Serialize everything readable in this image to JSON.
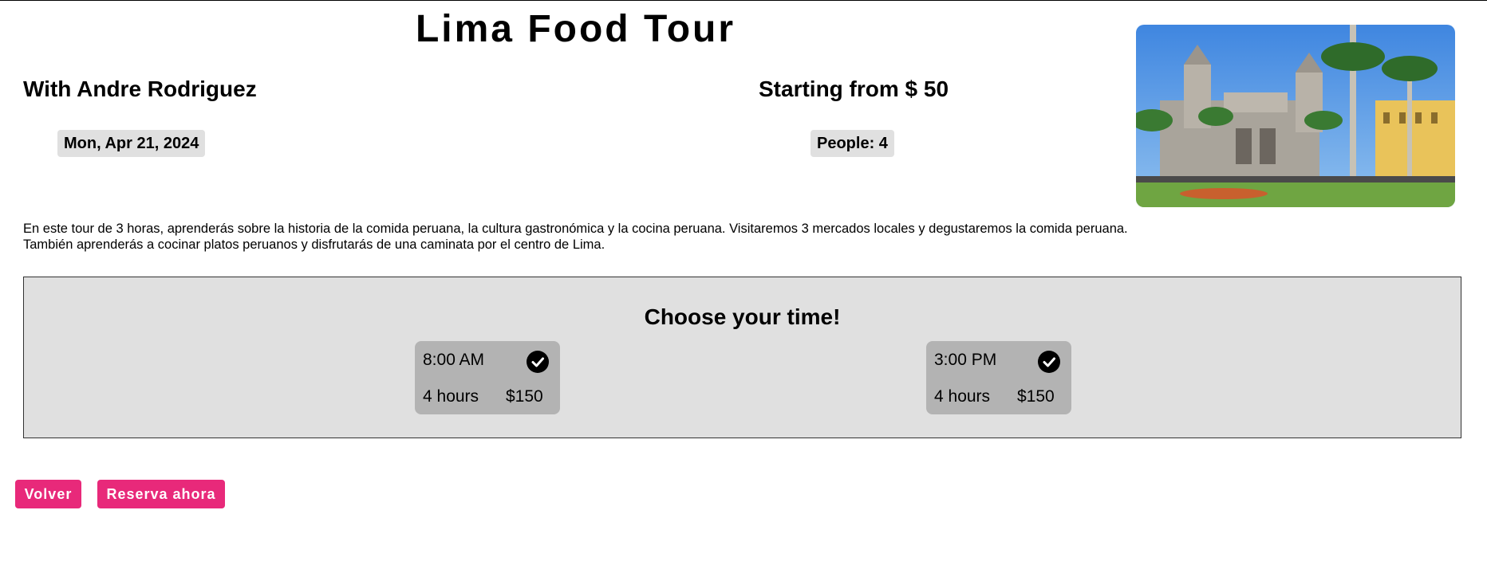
{
  "tour": {
    "title": "Lima Food Tour",
    "guide": "With Andre Rodriguez",
    "price_from": "Starting from $ 50",
    "date": "Mon, Apr 21, 2024",
    "people": "People: 4",
    "description": "En este tour de 3 horas, aprenderás sobre la historia de la comida peruana, la cultura gastronómica y la cocina peruana. Visitaremos 3 mercados locales y degustaremos la comida peruana. También aprenderás a cocinar platos peruanos y disfrutarás de una caminata por el centro de Lima."
  },
  "time_picker": {
    "heading": "Choose your time!",
    "slots": [
      {
        "time": "8:00 AM",
        "duration": "4 hours",
        "price": "$150",
        "selected": true
      },
      {
        "time": "3:00 PM",
        "duration": "4 hours",
        "price": "$150",
        "selected": true
      }
    ]
  },
  "actions": {
    "back_label": "Volver",
    "book_label": "Reserva ahora"
  },
  "colors": {
    "accent": "#e8297a",
    "pill_bg": "#e0e0e0",
    "panel_bg": "#e0e0e0",
    "slot_bg": "#b3b3b3"
  },
  "icons": {
    "slot_selected": "check-circle-icon"
  }
}
